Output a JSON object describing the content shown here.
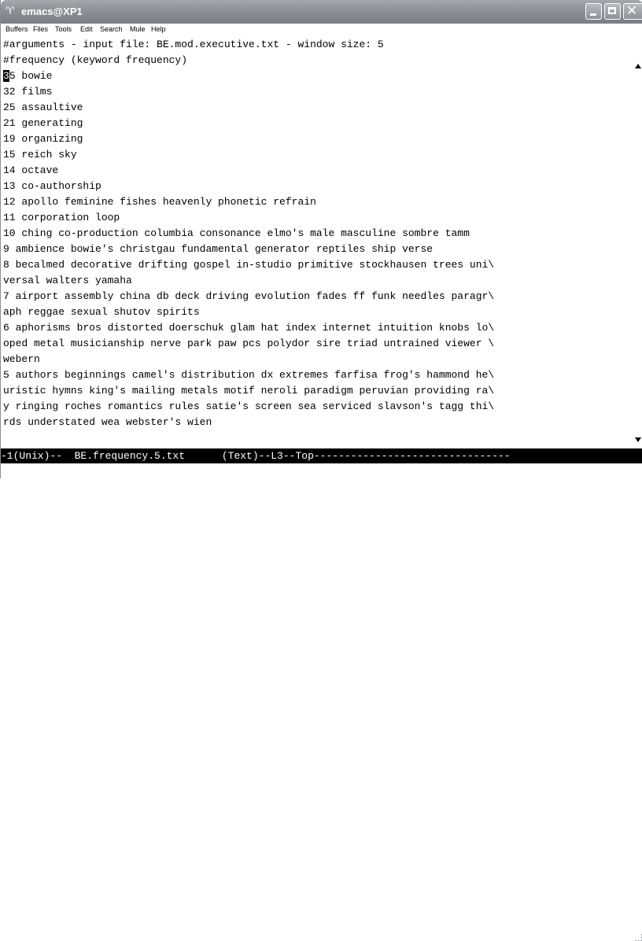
{
  "window": {
    "title": "emacs@XP1",
    "title_icon": "terminal-icon"
  },
  "menu": [
    "Buffers",
    "Files",
    "Tools",
    "Edit",
    "Search",
    "Mule",
    "Help"
  ],
  "buffer": {
    "cursor_char": "3",
    "lines": [
      "#arguments - input file: BE.mod.executive.txt - window size: 5",
      "#frequency (keyword frequency)",
      "5 bowie",
      "32 films",
      "25 assaultive",
      "21 generating",
      "19 organizing",
      "15 reich sky",
      "14 octave",
      "13 co-authorship",
      "12 apollo feminine fishes heavenly phonetic refrain",
      "11 corporation loop",
      "10 ching co-production columbia consonance elmo's male masculine sombre tamm",
      "9 ambience bowie's christgau fundamental generator reptiles ship verse",
      "8 becalmed decorative drifting gospel in-studio primitive stockhausen trees uni\\",
      "versal walters yamaha",
      "7 airport assembly china db deck driving evolution fades ff funk needles paragr\\",
      "aph reggae sexual shutov spirits",
      "6 aphorisms bros distorted doerschuk glam hat index internet intuition knobs lo\\",
      "oped metal musicianship nerve park paw pcs polydor sire triad untrained viewer \\",
      "webern",
      "5 authors beginnings camel's distribution dx extremes farfisa frog's hammond he\\",
      "uristic hymns king's mailing metals motif neroli paradigm peruvian providing ra\\",
      "y ringing roches romantics rules satie's screen sea serviced slavson's tagg thi\\",
      "rds understated wea webster's wien"
    ]
  },
  "modeline": "-1(Unix)--  BE.frequency.5.txt      (Text)--L3--Top--------------------------------"
}
